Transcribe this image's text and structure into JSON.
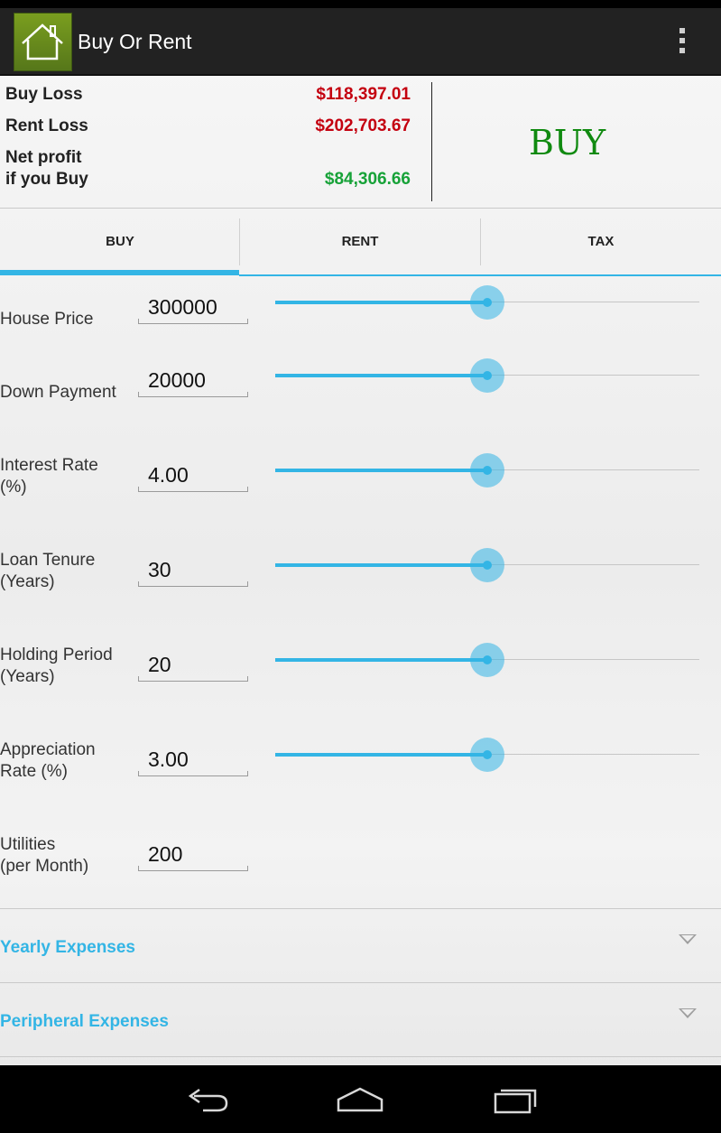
{
  "app": {
    "title": "Buy Or Rent"
  },
  "icons": {
    "app": "house-icon",
    "overflow": "overflow-menu-icon",
    "back": "back-icon",
    "home": "home-icon",
    "recents": "recents-icon",
    "expand": "chevron-down-icon"
  },
  "summary": {
    "buy_loss_label": "Buy Loss",
    "buy_loss_value": "$118,397.01",
    "rent_loss_label": "Rent Loss",
    "rent_loss_value": "$202,703.67",
    "net_profit_label_line1": "Net profit",
    "net_profit_label_line2": "if you Buy",
    "net_profit_value": "$84,306.66",
    "verdict": "BUY"
  },
  "tabs": [
    {
      "label": "BUY",
      "selected": true
    },
    {
      "label": "RENT",
      "selected": false
    },
    {
      "label": "TAX",
      "selected": false
    }
  ],
  "fields": [
    {
      "label_line1": "House Price",
      "label_line2": "",
      "value": "300000",
      "slider": 0.5
    },
    {
      "label_line1": "Down Payment",
      "label_line2": "",
      "value": "20000",
      "slider": 0.5
    },
    {
      "label_line1": "Interest Rate",
      "label_line2": "(%)",
      "value": "4.00",
      "slider": 0.5
    },
    {
      "label_line1": "Loan Tenure",
      "label_line2": "(Years)",
      "value": "30",
      "slider": 0.5
    },
    {
      "label_line1": "Holding Period",
      "label_line2": "(Years)",
      "value": "20",
      "slider": 0.5
    },
    {
      "label_line1": "Appreciation",
      "label_line2": "Rate (%)",
      "value": "3.00",
      "slider": 0.5
    },
    {
      "label_line1": "Utilities",
      "label_line2": "(per Month)",
      "value": "200"
    }
  ],
  "sections": [
    {
      "title": "Yearly Expenses"
    },
    {
      "title": "Peripheral Expenses"
    }
  ],
  "colors": {
    "accent": "#33b5e5",
    "loss": "#c4000f",
    "profit": "#17a238",
    "verdict": "#108a10",
    "actionbar": "#222222"
  }
}
